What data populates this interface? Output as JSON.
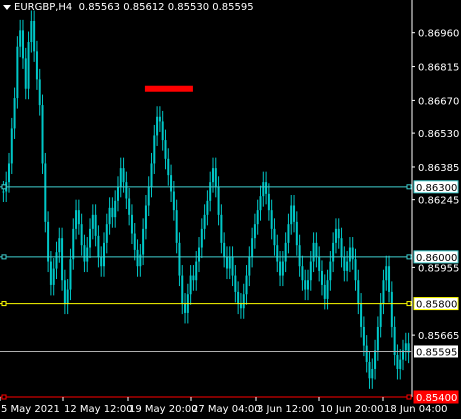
{
  "window": {
    "symbol": "EURGBP,H4",
    "ohlc": "0.85563 0.85612 0.85530 0.85595"
  },
  "colors": {
    "background": "#000000",
    "candles": "#00c8c8",
    "level_cyan": "#40d0d0",
    "level_yellow": "#ffff00",
    "level_red": "#ff0000",
    "bid_line": "#b0b0b0",
    "axis": "#ffffff",
    "grid_text": "#ffffff"
  },
  "price_axis": {
    "ticks": [
      "0.86960",
      "0.86815",
      "0.86670",
      "0.86530",
      "0.86385",
      "0.86245",
      "0.85955",
      "0.85665"
    ]
  },
  "time_axis": {
    "ticks": [
      "5 May 2021",
      "12 May 12:00",
      "19 May 20:00",
      "27 May 04:00",
      "3 Jun 12:00",
      "10 Jun 20:00",
      "18 Jun 04:00"
    ]
  },
  "levels": [
    {
      "name": "level-0.86300",
      "label": "0.86300",
      "price": 0.863,
      "color": "cyan"
    },
    {
      "name": "level-0.86000",
      "label": "0.86000",
      "price": 0.86,
      "color": "cyan"
    },
    {
      "name": "level-0.85800",
      "label": "0.85800",
      "price": 0.858,
      "color": "yellow"
    },
    {
      "name": "level-0.85400",
      "label": "0.85400",
      "price": 0.854,
      "color": "red"
    }
  ],
  "bid": {
    "label": "0.85595",
    "price": 0.85595
  },
  "marker": {
    "price": 0.8672,
    "time_fraction": 0.41
  },
  "chart_data": {
    "type": "candlestick",
    "title": "EURGBP,H4",
    "ylim": [
      0.854,
      0.8704
    ],
    "close_series": [
      0.8628,
      0.8632,
      0.864,
      0.8655,
      0.8668,
      0.869,
      0.8697,
      0.8685,
      0.8672,
      0.8692,
      0.8701,
      0.8688,
      0.8676,
      0.8665,
      0.864,
      0.8615,
      0.8598,
      0.8588,
      0.8595,
      0.8602,
      0.8608,
      0.859,
      0.858,
      0.8586,
      0.8599,
      0.8612,
      0.862,
      0.8614,
      0.8605,
      0.8598,
      0.8604,
      0.8612,
      0.8618,
      0.8609,
      0.86,
      0.8596,
      0.8606,
      0.8614,
      0.8621,
      0.8617,
      0.8624,
      0.863,
      0.8638,
      0.8632,
      0.8625,
      0.8618,
      0.861,
      0.8603,
      0.8596,
      0.8601,
      0.8612,
      0.8622,
      0.863,
      0.864,
      0.8652,
      0.866,
      0.8658,
      0.865,
      0.8642,
      0.8635,
      0.8628,
      0.862,
      0.8606,
      0.8592,
      0.858,
      0.8576,
      0.8584,
      0.8592,
      0.859,
      0.8598,
      0.8604,
      0.8612,
      0.8618,
      0.8624,
      0.8632,
      0.8638,
      0.863,
      0.8618,
      0.8606,
      0.86,
      0.8595,
      0.86,
      0.8592,
      0.8585,
      0.858,
      0.8578,
      0.8584,
      0.8592,
      0.86,
      0.8608,
      0.8614,
      0.862,
      0.8626,
      0.8632,
      0.8627,
      0.862,
      0.8612,
      0.8605,
      0.8598,
      0.8592,
      0.8598,
      0.8606,
      0.8614,
      0.8622,
      0.8615,
      0.8605,
      0.8596,
      0.859,
      0.8586,
      0.859,
      0.8598,
      0.8606,
      0.86,
      0.8594,
      0.8588,
      0.8582,
      0.859,
      0.8598,
      0.8606,
      0.8612,
      0.8608,
      0.86,
      0.8594,
      0.8598,
      0.8604,
      0.8599,
      0.859,
      0.858,
      0.857,
      0.8562,
      0.8555,
      0.8548,
      0.8552,
      0.856,
      0.857,
      0.858,
      0.859,
      0.8596,
      0.8585,
      0.857,
      0.8558,
      0.8552,
      0.8556,
      0.856,
      0.8563,
      0.8559
    ]
  }
}
